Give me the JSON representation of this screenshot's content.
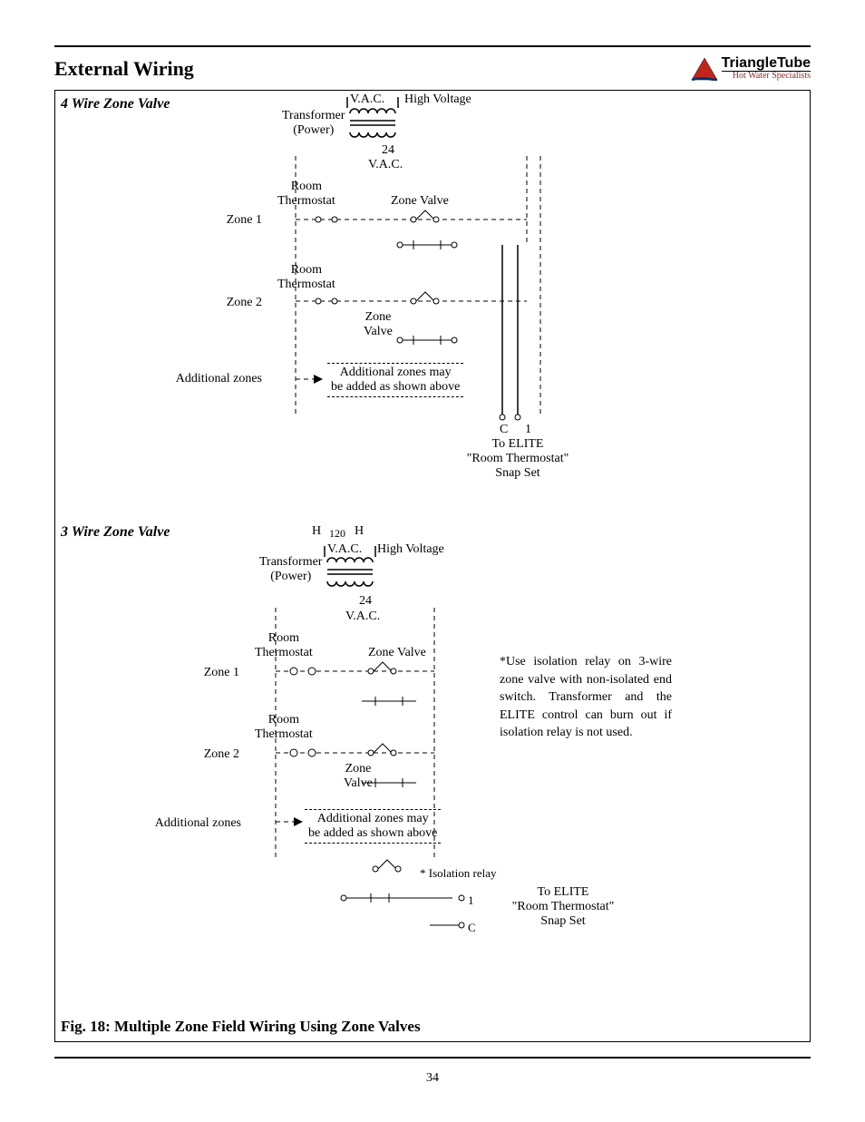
{
  "header": {
    "title": "External Wiring",
    "brand": "TriangleTube",
    "brand_sub": "Hot Water Specialists"
  },
  "page_number": "34",
  "figure_caption": "Fig. 18: Multiple Zone Field Wiring Using Zone Valves",
  "diagram_a": {
    "title": "4 Wire Zone Valve",
    "transformer": "Transformer\n(Power)",
    "vac_hi": "V.A.C.",
    "high_voltage": "High Voltage",
    "twentyfour": "24",
    "vac_lo": "V.A.C.",
    "room_thermostat": "Room\nThermostat",
    "zone_valve": "Zone Valve",
    "zone1": "Zone 1",
    "zone2": "Zone 2",
    "zone_valve2": "Zone\nValve",
    "additional_zones": "Additional  zones",
    "add_note": "Additional zones may\nbe added as shown above",
    "c": "C",
    "one": "1",
    "to_elite": "To ELITE\n\"Room Thermostat\"\nSnap Set"
  },
  "diagram_b": {
    "title": "3 Wire Zone Valve",
    "H": "H",
    "v120": "120",
    "transformer": "Transformer\n(Power)",
    "vac_hi": "V.A.C.",
    "high_voltage": "High Voltage",
    "twentyfour": "24",
    "vac_lo": "V.A.C.",
    "room_thermostat": "Room\nThermostat",
    "zone_valve": "Zone Valve",
    "zone1": "Zone 1",
    "zone2": "Zone 2",
    "zone_valve2": "Zone\nValve",
    "additional_zones": "Additional  zones",
    "add_note": "Additional zones may\nbe added as shown above",
    "iso_relay": "* Isolation relay",
    "one": "1",
    "c": "C",
    "to_elite": "To ELITE\n\"Room Thermostat\"\nSnap Set",
    "footnote": "*Use isolation relay on 3-wire zone valve with non-isolated end switch. Transformer and the ELITE control can burn out if isolation relay is not used."
  }
}
